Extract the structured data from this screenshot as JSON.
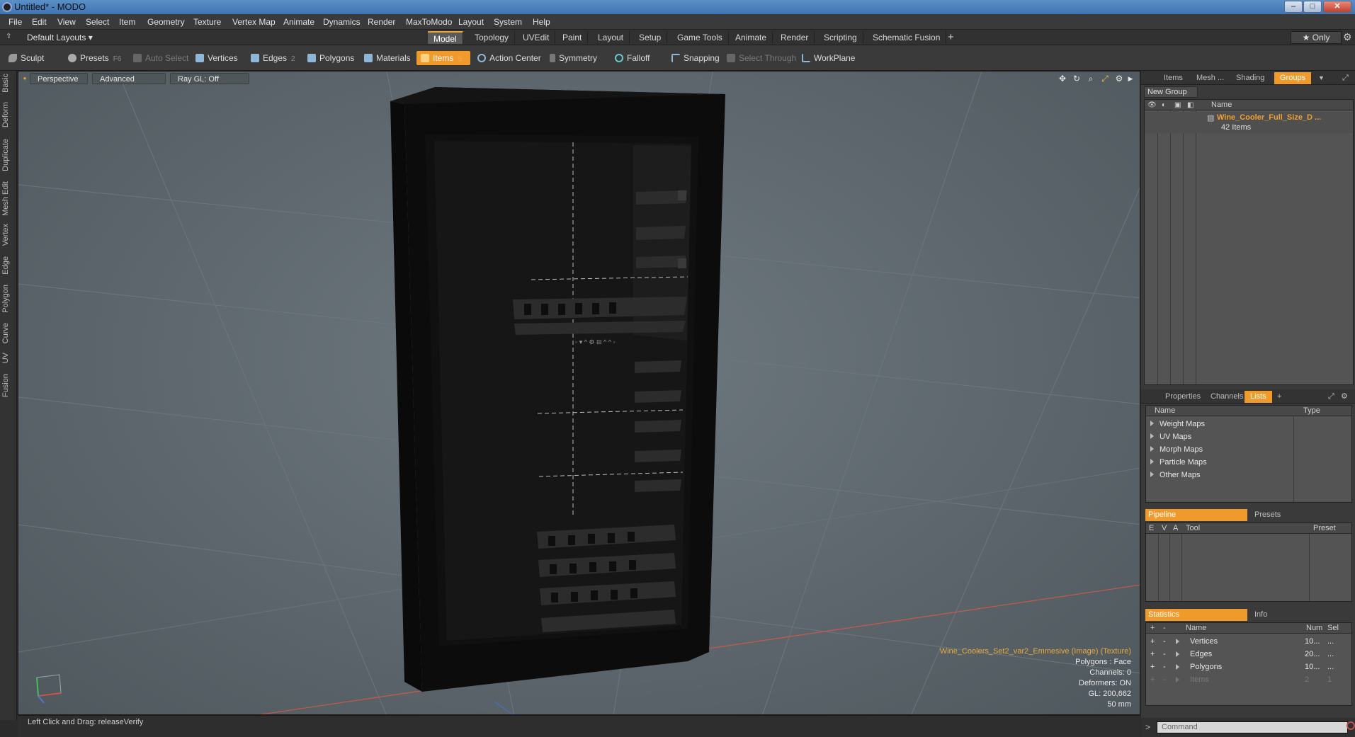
{
  "window": {
    "title": "Untitled* - MODO",
    "minimize": "–",
    "maximize": "□",
    "close": "✕"
  },
  "menu": [
    "File",
    "Edit",
    "View",
    "Select",
    "Item",
    "Geometry",
    "Texture",
    "Vertex Map",
    "Animate",
    "Dynamics",
    "Render",
    "MaxToModo",
    "Layout",
    "System",
    "Help"
  ],
  "layout_bar": {
    "layout_select": "Default Layouts ▾",
    "tabs": [
      "Model",
      "Topology",
      "UVEdit",
      "Paint",
      "Layout",
      "Setup",
      "Game Tools",
      "Animate",
      "Render",
      "Scripting",
      "Schematic Fusion"
    ],
    "active_tab": "Model",
    "add_tab": "+",
    "only_label": "★  Only"
  },
  "toolbar": {
    "sculpt": "Sculpt",
    "presets": "Presets",
    "presets_key": "F6",
    "auto_select": "Auto Select",
    "vertices": "Vertices",
    "edges": "Edges",
    "edges_count": "2",
    "polygons": "Polygons",
    "materials": "Materials",
    "items": "Items",
    "items_count": "5",
    "action_center": "Action Center",
    "symmetry": "Symmetry",
    "falloff": "Falloff",
    "snapping": "Snapping",
    "select_through": "Select Through",
    "workplane": "WorkPlane"
  },
  "left_tabs": [
    "Basic",
    "Deform",
    "Duplicate",
    "Mesh Edit",
    "Vertex",
    "Edge",
    "Polygon",
    "Curve",
    "UV",
    "Fusion"
  ],
  "viewport": {
    "view_mode": "Perspective",
    "advanced": "Advanced",
    "ray_gl": "Ray GL: Off",
    "fridge_display": "◦ ▾ ^ ⚙ ⊟ ^ ^ ◦",
    "info": {
      "texture": "Wine_Coolers_Set2_var2_Emmesive (Image) (Texture)",
      "polygons": "Polygons : Face",
      "channels": "Channels: 0",
      "deformers": "Deformers: ON",
      "gl": "GL: 200,662",
      "scale": "50 mm"
    }
  },
  "groups_panel": {
    "tabs": [
      "Items",
      "Mesh ...",
      "Shading",
      "Groups"
    ],
    "active_tab": "Groups",
    "new_group": "New Group",
    "name_header": "Name",
    "group_name": "Wine_Cooler_Full_Size_D ...",
    "group_count": "42 Items"
  },
  "lists_panel": {
    "tabs": [
      "Properties",
      "Channels",
      "Lists",
      "+"
    ],
    "active_tab": "Lists",
    "headers": [
      "Name",
      "Type"
    ],
    "items": [
      "Weight Maps",
      "UV Maps",
      "Morph Maps",
      "Particle Maps",
      "Other Maps"
    ]
  },
  "pipeline_panel": {
    "tabs": [
      "Pipeline",
      "Presets"
    ],
    "headers": [
      "E",
      "V",
      "A",
      "Tool",
      "Preset"
    ]
  },
  "stats_panel": {
    "tabs": [
      "Statistics",
      "Info"
    ],
    "headers": [
      "Name",
      "Num",
      "Sel"
    ],
    "rows": [
      {
        "name": "Vertices",
        "num": "10...",
        "sel": "..."
      },
      {
        "name": "Edges",
        "num": "20...",
        "sel": "..."
      },
      {
        "name": "Polygons",
        "num": "10...",
        "sel": "..."
      },
      {
        "name": "Items",
        "num": "2",
        "sel": "1"
      }
    ]
  },
  "command": {
    "placeholder": "Command"
  },
  "status": {
    "text": "Left Click and Drag:   releaseVerify"
  },
  "colors": {
    "accent": "#f09a2b",
    "viewport": "#5f696f",
    "group_name": "#f0a030"
  }
}
